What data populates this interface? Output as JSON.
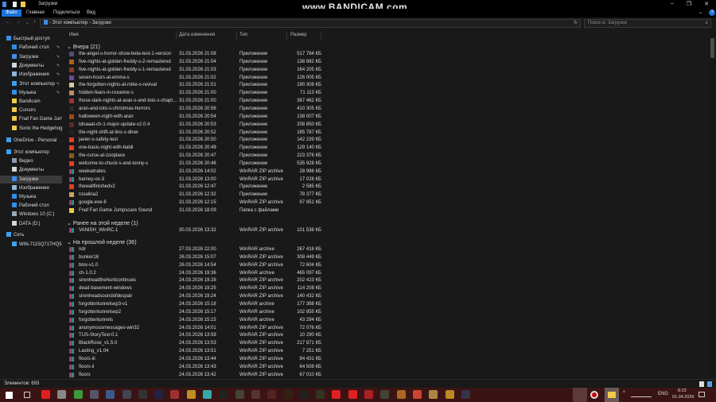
{
  "window": {
    "title": "Загрузки",
    "watermark": "www.BANDICAM.com",
    "minimize": "–",
    "maximize": "❐",
    "close": "✕",
    "help": "?",
    "expand": "⌄"
  },
  "ribbon": {
    "tabs": [
      "Файл",
      "Главная",
      "Поделиться",
      "Вид"
    ]
  },
  "address": {
    "back": "←",
    "forward": "→",
    "recent": "⌄",
    "up": "↑",
    "path": [
      "Этот компьютер",
      "Загрузки"
    ],
    "sep": "›",
    "refresh": "↻",
    "search_placeholder": "Поиск в: Загрузки",
    "search_icon": "⌕"
  },
  "sidebar": {
    "items": [
      {
        "label": "Быстрый доступ",
        "indent": 0,
        "color": "#3d8ee8",
        "pinned": false
      },
      {
        "label": "Рабочий стол",
        "indent": 1,
        "color": "#2f8ee6",
        "pinned": true
      },
      {
        "label": "Загрузки",
        "indent": 1,
        "color": "#3d8ee8",
        "pinned": true
      },
      {
        "label": "Документы",
        "indent": 1,
        "color": "#cfd8e3",
        "pinned": true
      },
      {
        "label": "Изображения",
        "indent": 1,
        "color": "#8fb5da",
        "pinned": true
      },
      {
        "label": "Этот компьютер",
        "indent": 1,
        "color": "#3aa0f0",
        "pinned": true
      },
      {
        "label": "Музыка",
        "indent": 1,
        "color": "#2f8ee6",
        "pinned": true
      },
      {
        "label": "Bandicam",
        "indent": 1,
        "color": "#f0c94a",
        "pinned": false
      },
      {
        "label": "Cursors",
        "indent": 1,
        "color": "#f0c94a",
        "pinned": false
      },
      {
        "label": "Fnaf Fan Game Jump",
        "indent": 1,
        "color": "#f0c94a",
        "pinned": false
      },
      {
        "label": "Sonic the Hedgehog",
        "indent": 1,
        "color": "#f0c94a",
        "pinned": false
      },
      {
        "label": "OneDrive - Personal",
        "indent": 0,
        "color": "#3aa0f0",
        "pinned": false
      },
      {
        "label": "Этот компьютер",
        "indent": 0,
        "color": "#3aa0f0",
        "pinned": false
      },
      {
        "label": "Видео",
        "indent": 1,
        "color": "#8a9ab0",
        "pinned": false
      },
      {
        "label": "Документы",
        "indent": 1,
        "color": "#cfd8e3",
        "pinned": false
      },
      {
        "label": "Загрузки",
        "indent": 1,
        "color": "#3d8ee8",
        "pinned": false,
        "selected": true
      },
      {
        "label": "Изображения",
        "indent": 1,
        "color": "#8fb5da",
        "pinned": false
      },
      {
        "label": "Музыка",
        "indent": 1,
        "color": "#2f8ee6",
        "pinned": false
      },
      {
        "label": "Рабочий стол",
        "indent": 1,
        "color": "#2f8ee6",
        "pinned": false
      },
      {
        "label": "Windows 10 (C:)",
        "indent": 1,
        "color": "#9aa8b5",
        "pinned": false
      },
      {
        "label": "DATA (D:)",
        "indent": 1,
        "color": "#cfd8e3",
        "pinned": false
      },
      {
        "label": "Сеть",
        "indent": 0,
        "color": "#3aa0f0",
        "pinned": false
      },
      {
        "label": "WIN-7115Q717HQ5",
        "indent": 1,
        "color": "#3aa0f0",
        "pinned": false
      }
    ]
  },
  "columns": {
    "name": "Имя",
    "date": "Дата изменения",
    "type": "Тип",
    "size": "Размер"
  },
  "groups": [
    {
      "title": "Вчера (21)",
      "files": [
        {
          "name": "the-angel-s-horror-show-beta-test-1-version",
          "date": "31.03.2026 21:08",
          "type": "Приложение",
          "size": "517 784 КБ",
          "icon": "#5a4a7a"
        },
        {
          "name": "five-nights-at-golden-freddy-s-2-remastered",
          "date": "31.03.2026 21:04",
          "type": "Приложение",
          "size": "138 882 КБ",
          "icon": "#b06020"
        },
        {
          "name": "five-nights-at-golden-freddy-s-1-remastered",
          "date": "31.03.2026 21:03",
          "type": "Приложение",
          "size": "164 205 КБ",
          "icon": "#8a3a1a"
        },
        {
          "name": "seven-hours-at-emma-s",
          "date": "31.03.2026 21:02",
          "type": "Приложение",
          "size": "126 005 КБ",
          "icon": "#6a4a9a"
        },
        {
          "name": "the-forgotten-nights-at-mike-s-revival",
          "date": "31.03.2026 21:01",
          "type": "Приложение",
          "size": "190 308 КБ",
          "icon": "#d0c8a0"
        },
        {
          "name": "hidden-fears-in-roxanne-s",
          "date": "31.03.2026 21:00",
          "type": "Приложение",
          "size": "71 113 КБ",
          "icon": "#c08a60"
        },
        {
          "name": "those-dark-nights-at-aran-s-and-toto-s-chapte...",
          "date": "31.03.2026 21:00",
          "type": "Приложение",
          "size": "387 462 КБ",
          "icon": "#a03030"
        },
        {
          "name": "aran-and-toto-s-christmas-horrors",
          "date": "31.03.2026 20:56",
          "type": "Приложение",
          "size": "410 305 КБ",
          "icon": "#2a2a2a"
        },
        {
          "name": "halloween-night-with-aran",
          "date": "31.03.2026 20:54",
          "type": "Приложение",
          "size": "138 007 КБ",
          "icon": "#a04a10"
        },
        {
          "name": "tdnaaat-ch-1-major-update-v2.0.4",
          "date": "31.03.2026 20:53",
          "type": "Приложение",
          "size": "208 850 КБ",
          "icon": "#5a2a2a"
        },
        {
          "name": "the-night-shift-at-lino-s-diner",
          "date": "31.03.2026 20:52",
          "type": "Приложение",
          "size": "185 787 КБ",
          "icon": "#222"
        },
        {
          "name": "javier-s-safety-test",
          "date": "31.03.2026 20:50",
          "type": "Приложение",
          "size": "142 239 КБ",
          "icon": "#e04020"
        },
        {
          "name": "one-basic-night-with-baldi",
          "date": "31.03.2026 20:49",
          "type": "Приложение",
          "size": "129 140 КБ",
          "icon": "#e04020"
        },
        {
          "name": "the-curse-at-zooplace",
          "date": "31.03.2026 20:47",
          "type": "Приложение",
          "size": "223 376 КБ",
          "icon": "#8a5a20"
        },
        {
          "name": "welcome-to-chuck-s-and-toony-s",
          "date": "31.03.2026 20:46",
          "type": "Приложение",
          "size": "535 928 КБ",
          "icon": "#e04020"
        },
        {
          "name": "weekatnates",
          "date": "31.03.2026 14:02",
          "type": "WinRAR ZIP archive",
          "size": "28 986 КБ",
          "icon": "rar"
        },
        {
          "name": "barney-os-3",
          "date": "31.03.2026 13:00",
          "type": "WinRAR ZIP archive",
          "size": "17 028 КБ",
          "icon": "rar"
        },
        {
          "name": "thewallfinishedv2",
          "date": "31.03.2026 12:47",
          "type": "Приложение",
          "size": "2 585 КБ",
          "icon": "#e04020"
        },
        {
          "name": "rosalina2",
          "date": "31.03.2026 12:32",
          "type": "Приложение",
          "size": "78 377 КБ",
          "icon": "#d0a060"
        },
        {
          "name": "google.exe-6",
          "date": "31.03.2026 12:15",
          "type": "WinRAR ZIP archive",
          "size": "97 851 КБ",
          "icon": "rar"
        },
        {
          "name": "Fnaf Fan Game Jumpscare Sound",
          "date": "31.03.2026 18:09",
          "type": "Папка с файлами",
          "size": "",
          "icon": "#f0c94a"
        }
      ]
    },
    {
      "title": "Ранее на этой неделе (1)",
      "files": [
        {
          "name": "VANISH_WinRC.1",
          "date": "30.03.2026 13:32",
          "type": "WinRAR ZIP archive",
          "size": "101 538 КБ",
          "icon": "rar"
        }
      ]
    },
    {
      "title": "На прошлой неделе (36)",
      "files": [
        {
          "name": "ndr",
          "date": "27.03.2026 22:00",
          "type": "WinRAR archive",
          "size": "267 416 КБ",
          "icon": "rar"
        },
        {
          "name": "bunker16",
          "date": "26.03.2026 15:07",
          "type": "WinRAR ZIP archive",
          "size": "308 449 КБ",
          "icon": "rar"
        },
        {
          "name": "blox-v1.0",
          "date": "26.03.2026 14:54",
          "type": "WinRAR ZIP archive",
          "size": "72 604 КБ",
          "icon": "rar"
        },
        {
          "name": "ch-1.0.2",
          "date": "24.03.2026 19:36",
          "type": "WinRAR archive",
          "size": "465 097 КБ",
          "icon": "rar"
        },
        {
          "name": "sirenheadthehuntcontinues",
          "date": "24.03.2026 19:28",
          "type": "WinRAR ZIP archive",
          "size": "202 423 КБ",
          "icon": "rar"
        },
        {
          "name": "dead-basement-windows",
          "date": "24.03.2026 19:25",
          "type": "WinRAR ZIP archive",
          "size": "114 208 КБ",
          "icon": "rar"
        },
        {
          "name": "sirenheadsoundofdespair",
          "date": "24.03.2026 19:24",
          "type": "WinRAR ZIP archive",
          "size": "140 432 КБ",
          "icon": "rar"
        },
        {
          "name": "forgottentunnelsep3-v1",
          "date": "24.03.2026 15:18",
          "type": "WinRAR archive",
          "size": "177 388 КБ",
          "icon": "rar"
        },
        {
          "name": "forgottentunnelsep2",
          "date": "24.03.2026 15:17",
          "type": "WinRAR archive",
          "size": "102 855 КБ",
          "icon": "rar"
        },
        {
          "name": "forgottentunnels",
          "date": "24.03.2026 15:15",
          "type": "WinRAR archive",
          "size": "43 294 КБ",
          "icon": "rar"
        },
        {
          "name": "anonymousmessages-win32",
          "date": "24.03.2026 14:01",
          "type": "WinRAR ZIP archive",
          "size": "72 076 КБ",
          "icon": "rar"
        },
        {
          "name": "TUS-StoryTest-0.1",
          "date": "24.03.2026 13:59",
          "type": "WinRAR ZIP archive",
          "size": "10 290 КБ",
          "icon": "rar"
        },
        {
          "name": "BlackRose_v1.5.0",
          "date": "24.03.2026 13:53",
          "type": "WinRAR ZIP archive",
          "size": "217 871 КБ",
          "icon": "rar"
        },
        {
          "name": "Lasting_v1.04",
          "date": "24.03.2026 13:51",
          "type": "WinRAR ZIP archive",
          "size": "7 251 КБ",
          "icon": "rar"
        },
        {
          "name": "floors-iii",
          "date": "24.03.2026 13:44",
          "type": "WinRAR ZIP archive",
          "size": "84 431 КБ",
          "icon": "rar"
        },
        {
          "name": "floors-ii",
          "date": "24.03.2026 13:43",
          "type": "WinRAR ZIP archive",
          "size": "64 508 КБ",
          "icon": "rar"
        },
        {
          "name": "floors",
          "date": "24.03.2026 13:42",
          "type": "WinRAR ZIP archive",
          "size": "67 010 КБ",
          "icon": "rar"
        }
      ]
    }
  ],
  "status": {
    "items": "Элементов: 693"
  },
  "taskbar": {
    "lang": "ENG",
    "time": "8:23",
    "date": "01.04.2026",
    "apps": [
      "#e02020",
      "#888",
      "#3a9a3a",
      "#556",
      "#3a5a8a",
      "#445",
      "#333",
      "#224",
      "#a03030",
      "#c09020",
      "#3aa",
      "#222",
      "#443",
      "#533",
      "#522",
      "#321",
      "#222",
      "#332",
      "#e02020",
      "#e02020",
      "#a22",
      "#443",
      "#a62",
      "#c43",
      "#a84",
      "#b82",
      "#334"
    ]
  },
  "colors": {
    "accent": "#1a73d9",
    "group": "#9fc3ff"
  }
}
